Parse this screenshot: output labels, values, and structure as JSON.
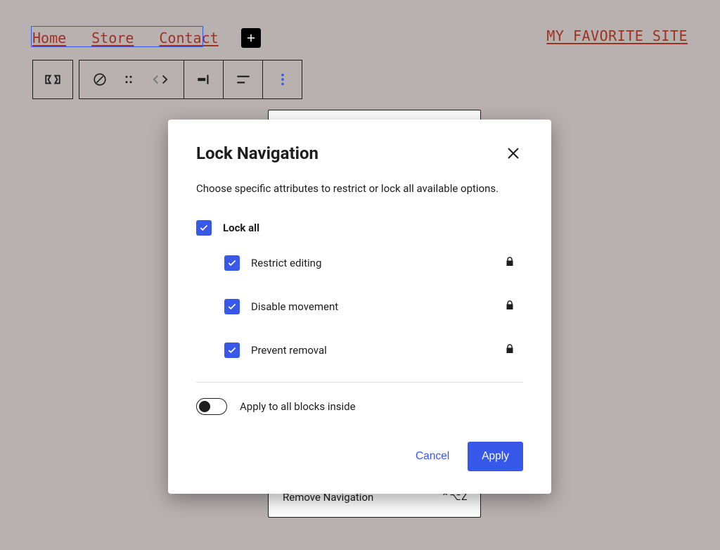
{
  "nav": {
    "links": [
      "Home",
      "Store",
      "Contact"
    ],
    "site_title": "MY FAVORITE SITE"
  },
  "bg_menu": {
    "remove_label": "Remove Navigation",
    "remove_kbd": "⌃⌥Z"
  },
  "modal": {
    "title": "Lock Navigation",
    "description": "Choose specific attributes to restrict or lock all available options.",
    "lock_all_label": "Lock all",
    "options": [
      {
        "label": "Restrict editing"
      },
      {
        "label": "Disable movement"
      },
      {
        "label": "Prevent removal"
      }
    ],
    "apply_all_label": "Apply to all blocks inside",
    "cancel_label": "Cancel",
    "apply_label": "Apply"
  }
}
